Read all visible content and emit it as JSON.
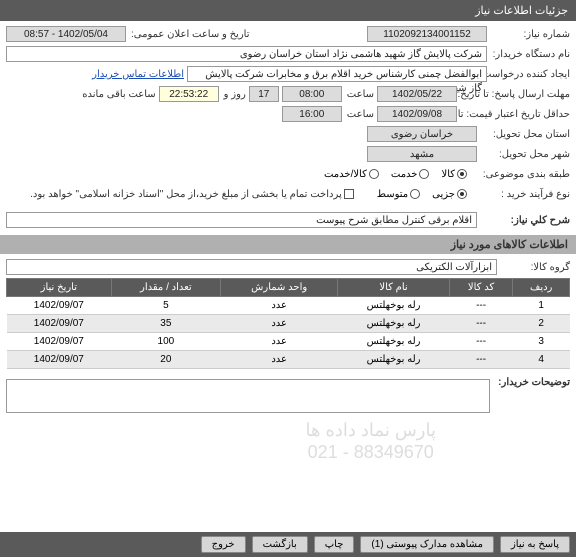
{
  "header": {
    "title": "جزئیات اطلاعات نیاز"
  },
  "fields": {
    "need_no_label": "شماره نیاز:",
    "need_no": "1102092134001152",
    "announce_label": "تاریخ و ساعت اعلان عمومی:",
    "announce_value": "1402/05/04 - 08:57",
    "buyer_label": "نام دستگاه خریدار:",
    "buyer_value": "شرکت پالایش گاز شهید هاشمی نژاد   استان خراسان رضوی",
    "creator_label": "ایجاد کننده درخواست:",
    "creator_value": "ابوالفضل چمنی کارشناس خرید اقلام برق و مخابرات شرکت پالایش گاز شهید ه",
    "contact_link": "اطلاعات تماس خریدار",
    "deadline_label": "مهلت ارسال پاسخ:  تا تاریخ:",
    "deadline_date": "1402/05/22",
    "saat1": "ساعت",
    "deadline_time": "08:00",
    "days": "17",
    "rooz_va": "روز و",
    "remain_time": "22:53:22",
    "remain_label": "ساعت باقی مانده",
    "validity_label": "حداقل تاریخ اعتبار قیمت: تا تاریخ:",
    "validity_date": "1402/09/08",
    "validity_time": "16:00",
    "province_label": "استان محل تحویل:",
    "province_value": "خراسان رضوی",
    "city_label": "شهر محل تحویل:",
    "city_value": "مشهد",
    "category_label": "طبقه بندی موضوعی:",
    "cat_kala": "کالا",
    "cat_khadamat": "خدمت",
    "cat_kalakhadamat": "کالا/خدمت",
    "process_label": "نوع فرآیند خرید :",
    "proc_jozi": "جزیی",
    "proc_motavaset": "متوسط",
    "pay_note": "پرداخت تمام یا بخشی از مبلغ خرید،از محل \"اسناد خزانه اسلامی\" خواهد بود.",
    "desc_label": "شرح کلي نياز:",
    "desc_value": "اقلام برقی کنترل مطابق شرح پیوست",
    "goods_header": "اطلاعات کالاهای مورد نیاز",
    "group_label": "گروه کالا:",
    "group_value": "ابزارآلات الکتریکی",
    "notes_label": "توضیحات خریدار:"
  },
  "table": {
    "headers": [
      "ردیف",
      "کد کالا",
      "نام کالا",
      "واحد شمارش",
      "تعداد / مقدار",
      "تاریخ نیاز"
    ],
    "rows": [
      {
        "n": "1",
        "code": "---",
        "name": "رله بوخهلتس",
        "unit": "عدد",
        "qty": "5",
        "date": "1402/09/07"
      },
      {
        "n": "2",
        "code": "---",
        "name": "رله بوخهلتس",
        "unit": "عدد",
        "qty": "35",
        "date": "1402/09/07"
      },
      {
        "n": "3",
        "code": "---",
        "name": "رله بوخهلتس",
        "unit": "عدد",
        "qty": "100",
        "date": "1402/09/07"
      },
      {
        "n": "4",
        "code": "---",
        "name": "رله بوخهلتس",
        "unit": "عدد",
        "qty": "20",
        "date": "1402/09/07"
      }
    ]
  },
  "watermark": {
    "line1": "پارس نماد داده ها",
    "line2": "021 - 88349670"
  },
  "footer": {
    "reply": "پاسخ به نیاز",
    "attachments": "مشاهده مدارک پیوستی (1)",
    "print": "چاپ",
    "back": "بازگشت",
    "close": "خروج"
  }
}
